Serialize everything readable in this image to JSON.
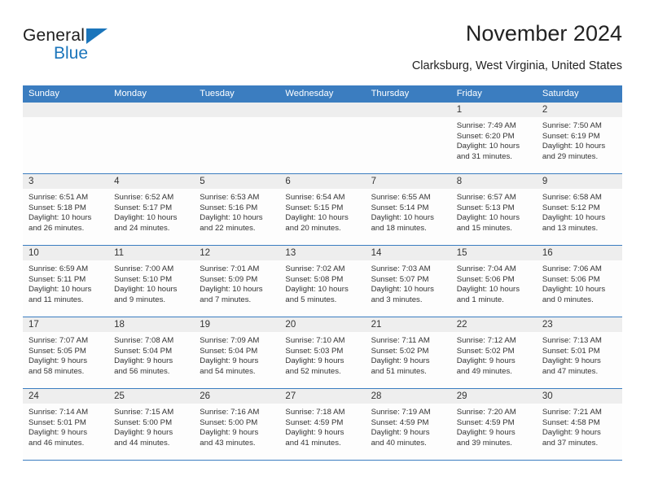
{
  "brand": {
    "word1": "General",
    "word2": "Blue",
    "triangle_color": "#1b75bb"
  },
  "header": {
    "title": "November 2024",
    "location": "Clarksburg, West Virginia, United States"
  },
  "theme": {
    "header_row_bg": "#3b7dc0",
    "day_band_bg": "#eeeeee",
    "cell_bg": "#fdfdfd",
    "row_divider": "#3b7dc0",
    "text": "#333333"
  },
  "calendar": {
    "weekdays": [
      "Sunday",
      "Monday",
      "Tuesday",
      "Wednesday",
      "Thursday",
      "Friday",
      "Saturday"
    ],
    "weeks": [
      [
        {
          "day": "",
          "empty": true
        },
        {
          "day": "",
          "empty": true
        },
        {
          "day": "",
          "empty": true
        },
        {
          "day": "",
          "empty": true
        },
        {
          "day": "",
          "empty": true
        },
        {
          "day": "1",
          "sunrise": "Sunrise: 7:49 AM",
          "sunset": "Sunset: 6:20 PM",
          "daylight1": "Daylight: 10 hours",
          "daylight2": "and 31 minutes."
        },
        {
          "day": "2",
          "sunrise": "Sunrise: 7:50 AM",
          "sunset": "Sunset: 6:19 PM",
          "daylight1": "Daylight: 10 hours",
          "daylight2": "and 29 minutes."
        }
      ],
      [
        {
          "day": "3",
          "sunrise": "Sunrise: 6:51 AM",
          "sunset": "Sunset: 5:18 PM",
          "daylight1": "Daylight: 10 hours",
          "daylight2": "and 26 minutes."
        },
        {
          "day": "4",
          "sunrise": "Sunrise: 6:52 AM",
          "sunset": "Sunset: 5:17 PM",
          "daylight1": "Daylight: 10 hours",
          "daylight2": "and 24 minutes."
        },
        {
          "day": "5",
          "sunrise": "Sunrise: 6:53 AM",
          "sunset": "Sunset: 5:16 PM",
          "daylight1": "Daylight: 10 hours",
          "daylight2": "and 22 minutes."
        },
        {
          "day": "6",
          "sunrise": "Sunrise: 6:54 AM",
          "sunset": "Sunset: 5:15 PM",
          "daylight1": "Daylight: 10 hours",
          "daylight2": "and 20 minutes."
        },
        {
          "day": "7",
          "sunrise": "Sunrise: 6:55 AM",
          "sunset": "Sunset: 5:14 PM",
          "daylight1": "Daylight: 10 hours",
          "daylight2": "and 18 minutes."
        },
        {
          "day": "8",
          "sunrise": "Sunrise: 6:57 AM",
          "sunset": "Sunset: 5:13 PM",
          "daylight1": "Daylight: 10 hours",
          "daylight2": "and 15 minutes."
        },
        {
          "day": "9",
          "sunrise": "Sunrise: 6:58 AM",
          "sunset": "Sunset: 5:12 PM",
          "daylight1": "Daylight: 10 hours",
          "daylight2": "and 13 minutes."
        }
      ],
      [
        {
          "day": "10",
          "sunrise": "Sunrise: 6:59 AM",
          "sunset": "Sunset: 5:11 PM",
          "daylight1": "Daylight: 10 hours",
          "daylight2": "and 11 minutes."
        },
        {
          "day": "11",
          "sunrise": "Sunrise: 7:00 AM",
          "sunset": "Sunset: 5:10 PM",
          "daylight1": "Daylight: 10 hours",
          "daylight2": "and 9 minutes."
        },
        {
          "day": "12",
          "sunrise": "Sunrise: 7:01 AM",
          "sunset": "Sunset: 5:09 PM",
          "daylight1": "Daylight: 10 hours",
          "daylight2": "and 7 minutes."
        },
        {
          "day": "13",
          "sunrise": "Sunrise: 7:02 AM",
          "sunset": "Sunset: 5:08 PM",
          "daylight1": "Daylight: 10 hours",
          "daylight2": "and 5 minutes."
        },
        {
          "day": "14",
          "sunrise": "Sunrise: 7:03 AM",
          "sunset": "Sunset: 5:07 PM",
          "daylight1": "Daylight: 10 hours",
          "daylight2": "and 3 minutes."
        },
        {
          "day": "15",
          "sunrise": "Sunrise: 7:04 AM",
          "sunset": "Sunset: 5:06 PM",
          "daylight1": "Daylight: 10 hours",
          "daylight2": "and 1 minute."
        },
        {
          "day": "16",
          "sunrise": "Sunrise: 7:06 AM",
          "sunset": "Sunset: 5:06 PM",
          "daylight1": "Daylight: 10 hours",
          "daylight2": "and 0 minutes."
        }
      ],
      [
        {
          "day": "17",
          "sunrise": "Sunrise: 7:07 AM",
          "sunset": "Sunset: 5:05 PM",
          "daylight1": "Daylight: 9 hours",
          "daylight2": "and 58 minutes."
        },
        {
          "day": "18",
          "sunrise": "Sunrise: 7:08 AM",
          "sunset": "Sunset: 5:04 PM",
          "daylight1": "Daylight: 9 hours",
          "daylight2": "and 56 minutes."
        },
        {
          "day": "19",
          "sunrise": "Sunrise: 7:09 AM",
          "sunset": "Sunset: 5:04 PM",
          "daylight1": "Daylight: 9 hours",
          "daylight2": "and 54 minutes."
        },
        {
          "day": "20",
          "sunrise": "Sunrise: 7:10 AM",
          "sunset": "Sunset: 5:03 PM",
          "daylight1": "Daylight: 9 hours",
          "daylight2": "and 52 minutes."
        },
        {
          "day": "21",
          "sunrise": "Sunrise: 7:11 AM",
          "sunset": "Sunset: 5:02 PM",
          "daylight1": "Daylight: 9 hours",
          "daylight2": "and 51 minutes."
        },
        {
          "day": "22",
          "sunrise": "Sunrise: 7:12 AM",
          "sunset": "Sunset: 5:02 PM",
          "daylight1": "Daylight: 9 hours",
          "daylight2": "and 49 minutes."
        },
        {
          "day": "23",
          "sunrise": "Sunrise: 7:13 AM",
          "sunset": "Sunset: 5:01 PM",
          "daylight1": "Daylight: 9 hours",
          "daylight2": "and 47 minutes."
        }
      ],
      [
        {
          "day": "24",
          "sunrise": "Sunrise: 7:14 AM",
          "sunset": "Sunset: 5:01 PM",
          "daylight1": "Daylight: 9 hours",
          "daylight2": "and 46 minutes."
        },
        {
          "day": "25",
          "sunrise": "Sunrise: 7:15 AM",
          "sunset": "Sunset: 5:00 PM",
          "daylight1": "Daylight: 9 hours",
          "daylight2": "and 44 minutes."
        },
        {
          "day": "26",
          "sunrise": "Sunrise: 7:16 AM",
          "sunset": "Sunset: 5:00 PM",
          "daylight1": "Daylight: 9 hours",
          "daylight2": "and 43 minutes."
        },
        {
          "day": "27",
          "sunrise": "Sunrise: 7:18 AM",
          "sunset": "Sunset: 4:59 PM",
          "daylight1": "Daylight: 9 hours",
          "daylight2": "and 41 minutes."
        },
        {
          "day": "28",
          "sunrise": "Sunrise: 7:19 AM",
          "sunset": "Sunset: 4:59 PM",
          "daylight1": "Daylight: 9 hours",
          "daylight2": "and 40 minutes."
        },
        {
          "day": "29",
          "sunrise": "Sunrise: 7:20 AM",
          "sunset": "Sunset: 4:59 PM",
          "daylight1": "Daylight: 9 hours",
          "daylight2": "and 39 minutes."
        },
        {
          "day": "30",
          "sunrise": "Sunrise: 7:21 AM",
          "sunset": "Sunset: 4:58 PM",
          "daylight1": "Daylight: 9 hours",
          "daylight2": "and 37 minutes."
        }
      ]
    ]
  }
}
